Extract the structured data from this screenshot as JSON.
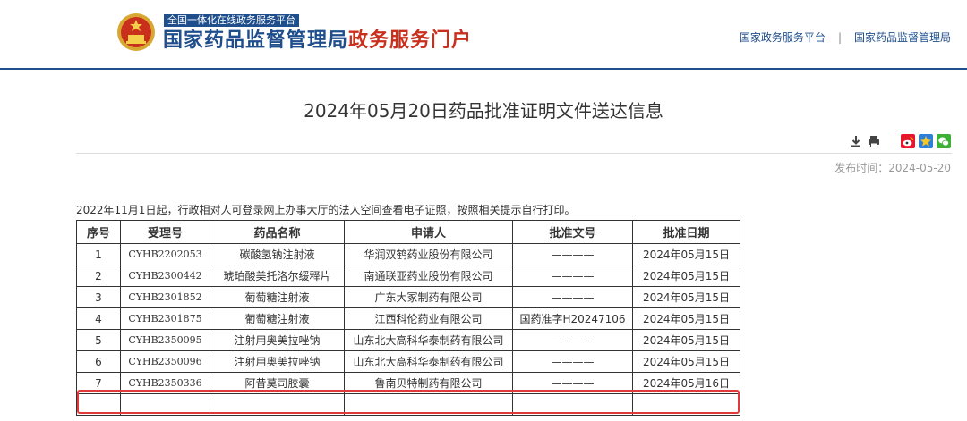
{
  "header": {
    "tagline": "全国一体化在线政务服务平台",
    "title_main": "国家药品监督管理局",
    "title_accent": "政务服务门户",
    "links": [
      "国家政务服务平台",
      "国家药品监督管理局"
    ],
    "separator": "|"
  },
  "page_title": "2024年05月20日药品批准证明文件送达信息",
  "toolbar": {
    "icons": [
      "download-icon",
      "print-icon",
      "weibo-share-icon",
      "qzone-share-icon",
      "wechat-share-icon"
    ]
  },
  "publish": {
    "label": "发布时间：",
    "date": "2024-05-20"
  },
  "notice": "2022年11月1日起，行政相对人可登录网上办事大厅的法人空间查看电子证照，按照相关提示自行打印。",
  "table": {
    "headers": [
      "序号",
      "受理号",
      "药品名称",
      "申请人",
      "批准文号",
      "批准日期"
    ],
    "rows": [
      [
        "1",
        "CYHB2202053",
        "碳酸氢钠注射液",
        "华润双鹤药业股份有限公司",
        "————",
        "2024年05月15日"
      ],
      [
        "2",
        "CYHB2300442",
        "琥珀酸美托洛尔缓释片",
        "南通联亚药业股份有限公司",
        "————",
        "2024年05月15日"
      ],
      [
        "3",
        "CYHB2301852",
        "葡萄糖注射液",
        "广东大冢制药有限公司",
        "————",
        "2024年05月15日"
      ],
      [
        "4",
        "CYHB2301875",
        "葡萄糖注射液",
        "江西科伦药业有限公司",
        "国药准字H20247106",
        "2024年05月15日"
      ],
      [
        "5",
        "CYHB2350095",
        "注射用奥美拉唑钠",
        "山东北大高科华泰制药有限公司",
        "————",
        "2024年05月15日"
      ],
      [
        "6",
        "CYHB2350096",
        "注射用奥美拉唑钠",
        "山东北大高科华泰制药有限公司",
        "————",
        "2024年05月15日"
      ],
      [
        "7",
        "CYHB2350336",
        "阿昔莫司胶囊",
        "鲁南贝特制药有限公司",
        "————",
        "2024年05月16日"
      ]
    ],
    "highlighted_row": 7
  },
  "colors": {
    "brand_blue": "#1f4e8c",
    "brand_red": "#c9301c",
    "highlight_red": "#e0393a"
  }
}
